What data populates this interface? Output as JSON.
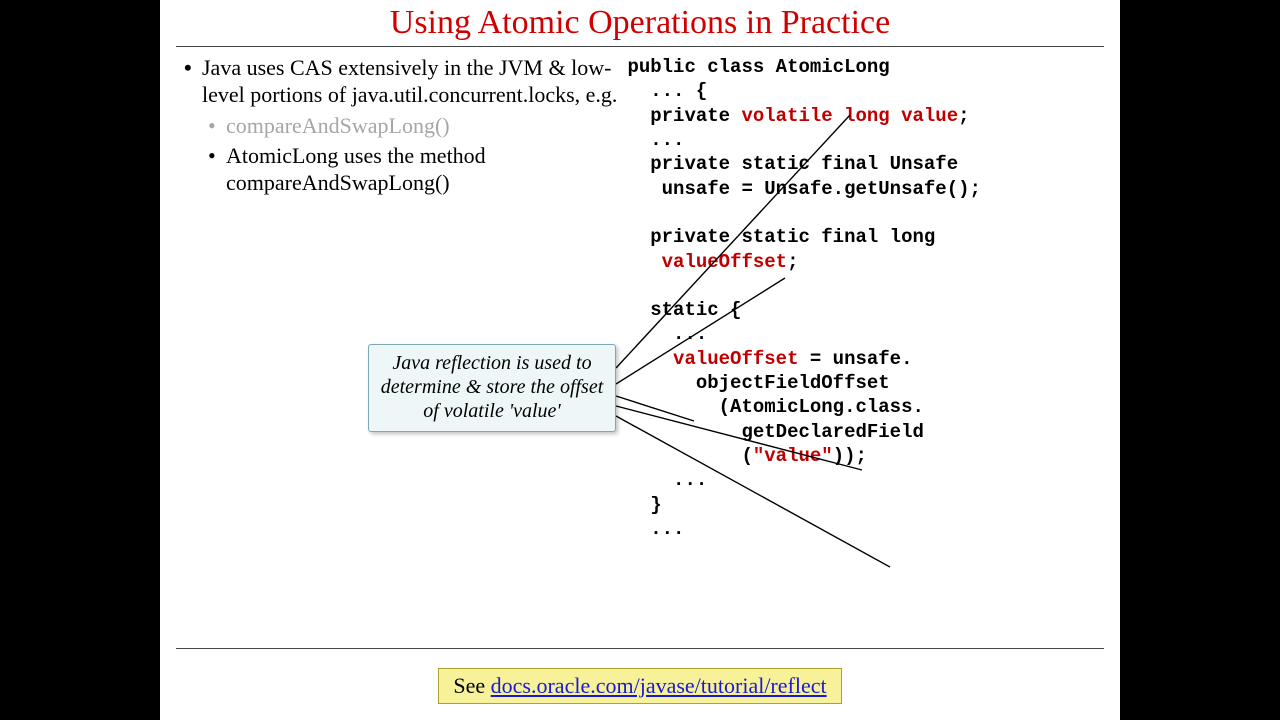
{
  "title": "Using Atomic Operations in Practice",
  "bullets": {
    "main1": "Java uses CAS extensively in the JVM & low-level portions of java.util.concurrent.locks, e.g.",
    "sub1": "compareAndSwapLong()",
    "sub2": "AtomicLong uses the method compareAndSwapLong()"
  },
  "callout": "Java reflection is used to determine & store the offset of volatile 'value'",
  "code": {
    "l1": "public class AtomicLong",
    "l2": "  ... {",
    "l3a": "  private ",
    "l3b": "volatile long value",
    "l3c": ";",
    "l4": "  ...",
    "l5": "  private static final Unsafe",
    "l6": "   unsafe = Unsafe.getUnsafe();",
    "l7": "",
    "l8": "  private static final long",
    "l9a": "   ",
    "l9b": "valueOffset",
    "l9c": ";",
    "l10": "",
    "l11": "  static {",
    "l12": "    ...",
    "l13a": "    ",
    "l13b": "valueOffset",
    "l13c": " = unsafe.",
    "l14": "      objectFieldOffset",
    "l15": "        (AtomicLong.class.",
    "l16": "          getDeclaredField",
    "l17a": "          (",
    "l17b": "\"value\"",
    "l17c": "));",
    "l18": "    ...",
    "l19": "  }",
    "l20": "  ..."
  },
  "footer": {
    "prefix": "See ",
    "link": "docs.oracle.com/javase/tutorial/reflect"
  }
}
